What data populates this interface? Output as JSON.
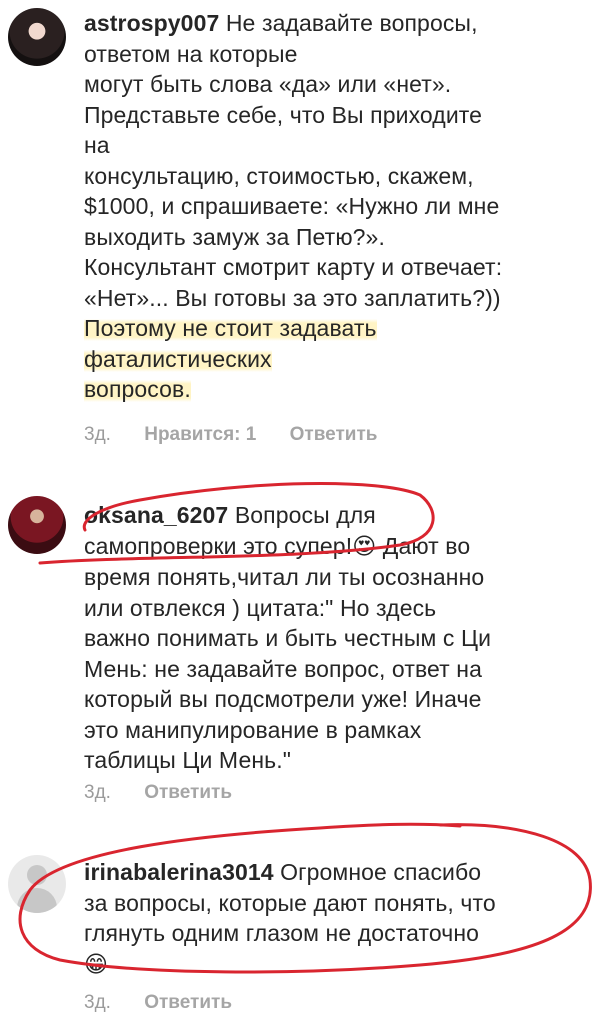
{
  "comments": [
    {
      "username": "astrospy007",
      "lines": [
        " Не задавайте вопросы,",
        "ответом на которые",
        "могут быть слова «да» или «нет».",
        "Представьте себе, что Вы приходите",
        "на",
        "консультацию, стоимостью, скажем,",
        "$1000, и спрашиваете: «Нужно ли мне",
        "выходить замуж за Петю?».",
        "Консультант смотрит карту и отвечает:",
        "«Нет»... Вы готовы за это заплатить?))",
        "Поэтому не стоит задавать",
        "фаталистических",
        "вопросов."
      ],
      "time": "3д.",
      "likes": "Нравится: 1",
      "reply": "Ответить"
    },
    {
      "username": "oksana_6207",
      "lines": [
        " Вопросы для",
        "самопроверки это супер!",
        "время понять,читал ли ты осознанно",
        "или отвлекся ) цитата:\" Но здесь",
        "важно понимать и быть честным с Ци",
        "Мень: не задавайте вопрос, ответ на",
        "который вы подсмотрели уже! Иначе",
        "это манипулирование в рамках",
        "таблицы Ци Мень.\""
      ],
      "line2_tail": " Дают во",
      "emoji_heart_eyes": "😍",
      "time": "3д.",
      "reply": "Ответить"
    },
    {
      "username": "irinabalerina3014",
      "lines": [
        " Огромное спасибо",
        "за вопросы, которые дают понять, что",
        "глянуть одним глазом не достаточно"
      ],
      "emoji_grin": "😁",
      "time": "3д.",
      "reply": "Ответить"
    }
  ],
  "colors": {
    "text": "#262626",
    "meta": "#9b9b9b",
    "annotation_red": "#d9252f",
    "highlight": "#ffeb96"
  }
}
